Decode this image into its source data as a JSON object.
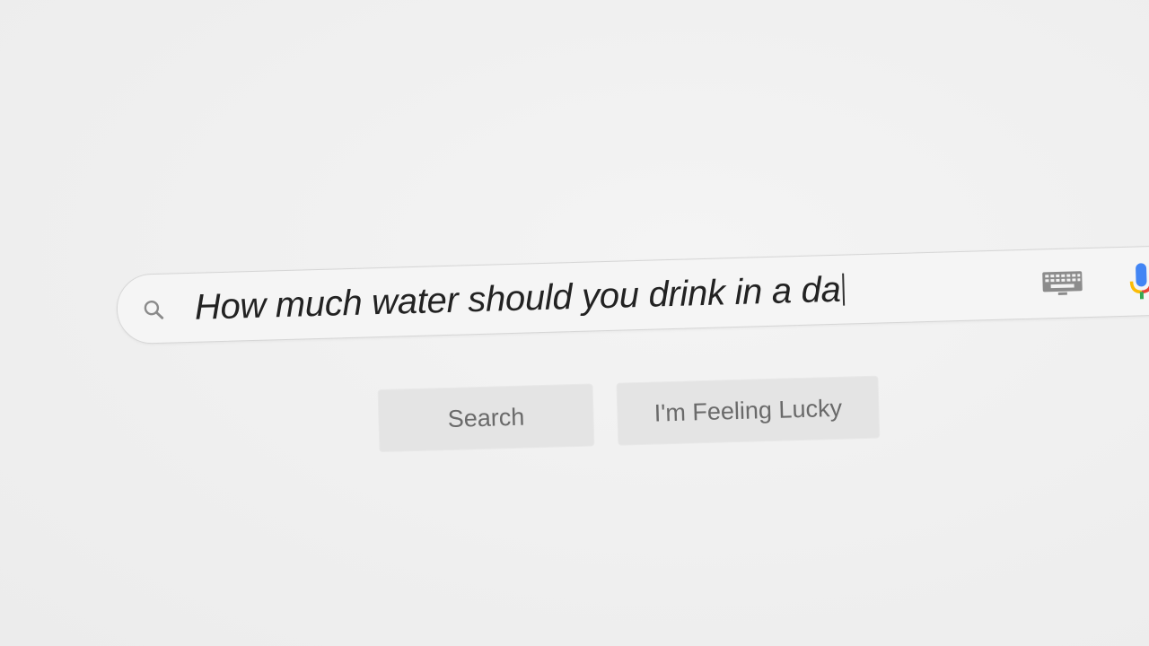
{
  "search": {
    "query": "How much water should you drink in a da",
    "icons": {
      "search": "search-icon",
      "keyboard": "keyboard-icon",
      "voice": "microphone-icon"
    }
  },
  "buttons": {
    "search_label": "Search",
    "lucky_label": "I'm Feeling Lucky"
  },
  "colors": {
    "background": "#f1f1f1",
    "button_bg": "#e4e4e4",
    "button_text": "#6a6a6a",
    "query_text": "#222222",
    "mic_blue": "#4285f4",
    "mic_red": "#ea4335",
    "mic_yellow": "#fbbc05"
  }
}
